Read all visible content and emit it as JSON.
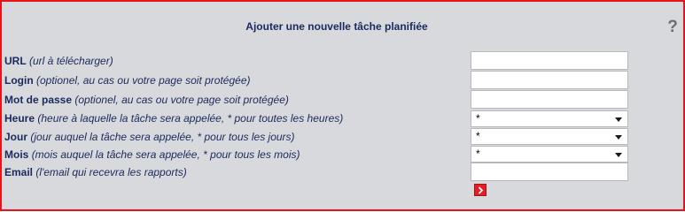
{
  "form": {
    "title": "Ajouter une nouvelle tâche planifiée",
    "help_symbol": "?",
    "fields": [
      {
        "name": "URL",
        "hint": "(url à télécharger)",
        "value": ""
      },
      {
        "name": "Login",
        "hint": "(optionel, au cas ou votre page soit protégée)",
        "value": ""
      },
      {
        "name": "Mot de passe",
        "hint": "(optionel, au cas ou votre page soit protégée)",
        "value": ""
      },
      {
        "name": "Heure",
        "hint": "(heure à laquelle la tâche sera appelée, * pour toutes les heures)",
        "value": "*"
      },
      {
        "name": "Jour",
        "hint": "(jour auquel la tâche sera appelée, * pour tous les jours)",
        "value": "*"
      },
      {
        "name": "Mois",
        "hint": "(mois auquel la tâche sera appelée, * pour tous les mois)",
        "value": "*"
      },
      {
        "name": "Email",
        "hint": "(l'email qui recevra les rapports)",
        "value": ""
      }
    ],
    "submit_icon": "chevron-right-icon"
  },
  "colors": {
    "border": "#e8141c",
    "background": "#d8d9dc",
    "text": "#1a2a5e",
    "submit": "#e31e24"
  }
}
